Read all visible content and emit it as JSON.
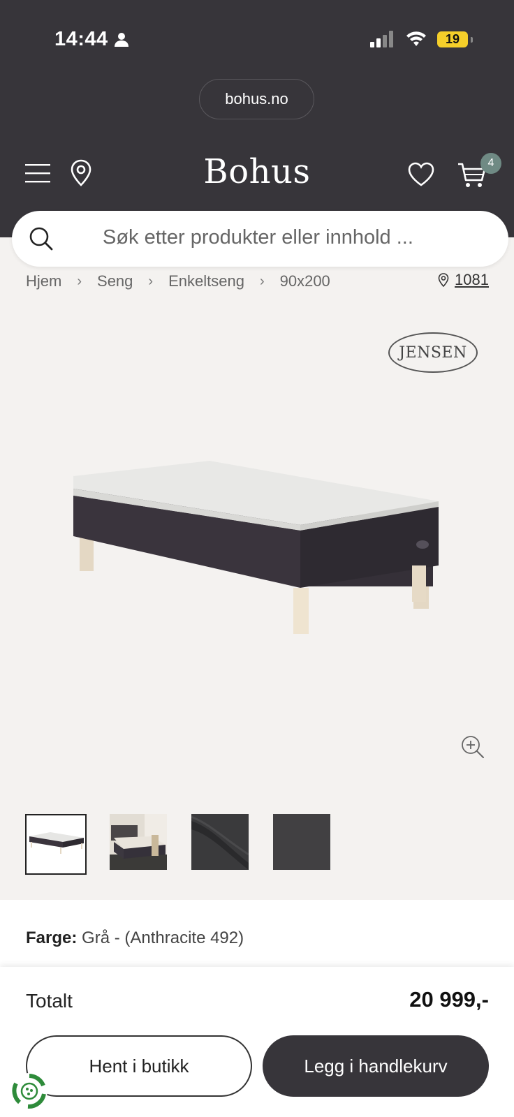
{
  "status_bar": {
    "time": "14:44",
    "battery": "19"
  },
  "browser": {
    "url": "bohus.no"
  },
  "header": {
    "brand": "Bohus",
    "cart_count": "4"
  },
  "search": {
    "placeholder": "Søk etter produkter eller innhold ..."
  },
  "breadcrumb": [
    "Hjem",
    "Seng",
    "Enkeltseng",
    "90x200"
  ],
  "store": {
    "code": "1081"
  },
  "product": {
    "brand_logo": "JENSEN",
    "color_label": "Farge:",
    "color_value": "Grå - (Anthracite 492)"
  },
  "checkout": {
    "total_label": "Totalt",
    "total_price": "20 999,-",
    "pickup_button": "Hent i butikk",
    "add_to_cart_button": "Legg i handlekurv"
  },
  "colors": {
    "header_bg": "#37353a",
    "page_bg": "#f4f2f0",
    "badge": "#6f8a84",
    "battery": "#f5cf2a"
  }
}
